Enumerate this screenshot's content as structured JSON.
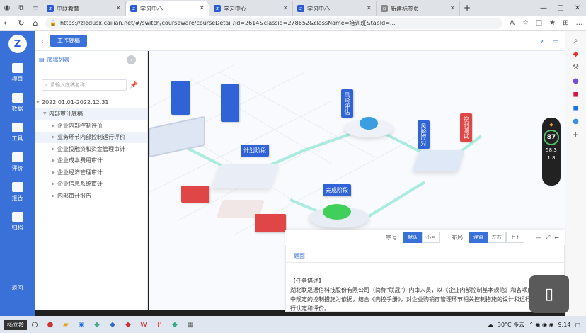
{
  "browser": {
    "tabs": [
      {
        "label": "中联教育",
        "active": false
      },
      {
        "label": "学习中心",
        "active": true
      },
      {
        "label": "学习中心",
        "active": false
      },
      {
        "label": "学习中心",
        "active": false
      },
      {
        "label": "新建标签页",
        "active": false
      }
    ],
    "url": "https://zledusx.cailian.net/#/switch/courseware/courseDetail?id=2614&classid=278652&className=培训班&tabId=..."
  },
  "app": {
    "sidebar": [
      {
        "label": "项目",
        "icon": "folder-icon"
      },
      {
        "label": "数据",
        "icon": "bar-chart-icon"
      },
      {
        "label": "工具",
        "icon": "briefcase-icon"
      },
      {
        "label": "评价",
        "icon": "sliders-icon"
      },
      {
        "label": "报告",
        "icon": "document-icon"
      },
      {
        "label": "归档",
        "icon": "archive-icon"
      }
    ],
    "return_label": "返回",
    "header_button": "工作底稿"
  },
  "left_pane": {
    "title": "底稿列表",
    "search_placeholder": "请输入底稿名称",
    "tree": [
      {
        "label": "2022.01.01-2022.12.31",
        "level": 0
      },
      {
        "label": "内部审计底稿",
        "level": 1
      },
      {
        "label": "企业内部控制评价",
        "level": 2
      },
      {
        "label": "业务环节内部控制运行评价",
        "level": 2
      },
      {
        "label": "企业投融资和资金管理审计",
        "level": 2
      },
      {
        "label": "企业成本费用审计",
        "level": 2
      },
      {
        "label": "企业经济管理审计",
        "level": 2
      },
      {
        "label": "企业信息系统审计",
        "level": 2
      },
      {
        "label": "内部审计报告",
        "level": 2
      }
    ]
  },
  "diagram": {
    "flags": [
      "计划阶段",
      "风险评估",
      "风险应对",
      "完成阶段",
      "控制测试"
    ]
  },
  "panel": {
    "font_label": "字号:",
    "font_options": [
      "默认",
      "小号"
    ],
    "layout_label": "布局:",
    "layout_options": [
      "浮窗",
      "左右",
      "上下"
    ],
    "title": "题面",
    "task_title": "【任务描述】",
    "task_text": "湖北联晟通信科技股份有限公司（简称\"联晟\"）内审人员，以《企业内部控制基本规范》和各项应用指引中规定的控制措施为依据，结合《内控手册》，对企业购销存管理环节相关控制措施的设计和运行有效性进行认定和评价。"
  },
  "widget": {
    "value": "87",
    "up": "58.3",
    "down": "1.8"
  },
  "taskbar": {
    "user": "杨立羚",
    "weather": "30°C 多云",
    "time": "9:14"
  }
}
